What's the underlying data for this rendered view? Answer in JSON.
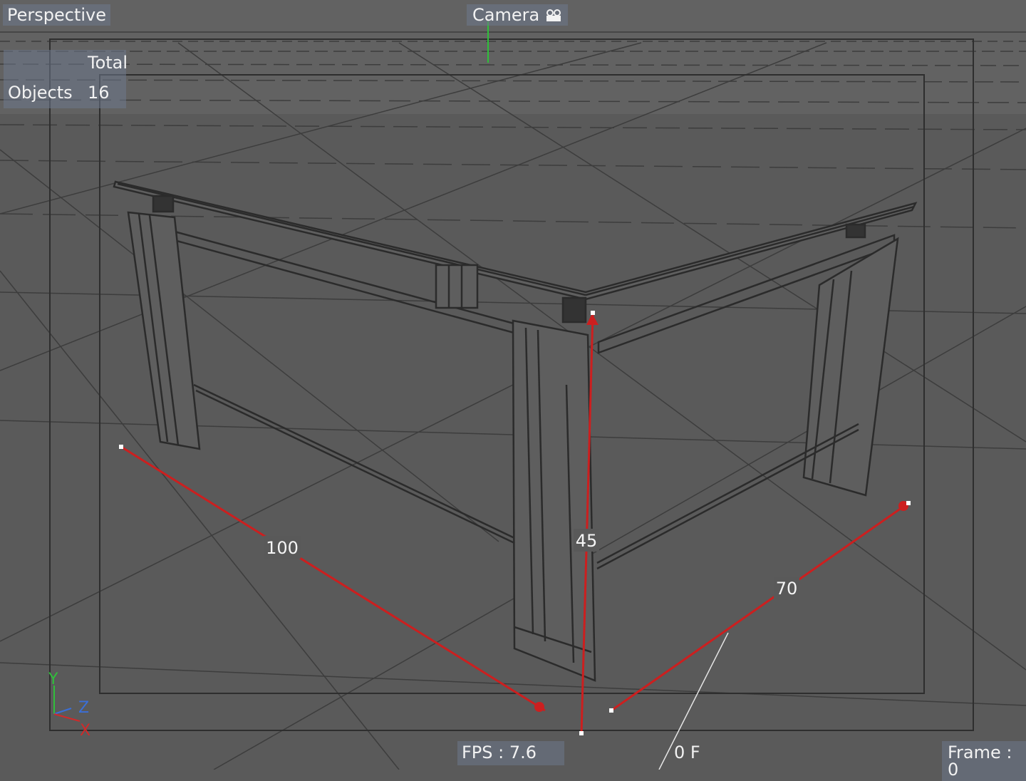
{
  "viewport": {
    "view_name": "Perspective",
    "camera_label": "Camera",
    "camera_icon": "camera-icon",
    "stats": {
      "header": "Total",
      "row_label": "Objects",
      "row_value": "16"
    },
    "dimensions": {
      "width": "100",
      "height": "45",
      "depth": "70"
    },
    "axes": {
      "y": "Y",
      "z": "Z",
      "x": "X"
    },
    "status": {
      "fps": "FPS : 7.6",
      "frame_field": "0 F",
      "frame": "Frame : 0"
    }
  },
  "colors": {
    "background": "#5a5a5a",
    "wire": "#2b2b2b",
    "dimension_line": "#cc1f1f",
    "axis_y": "#2fbf3a",
    "axis_z": "#3a6fd8",
    "axis_x": "#d02a2a"
  }
}
